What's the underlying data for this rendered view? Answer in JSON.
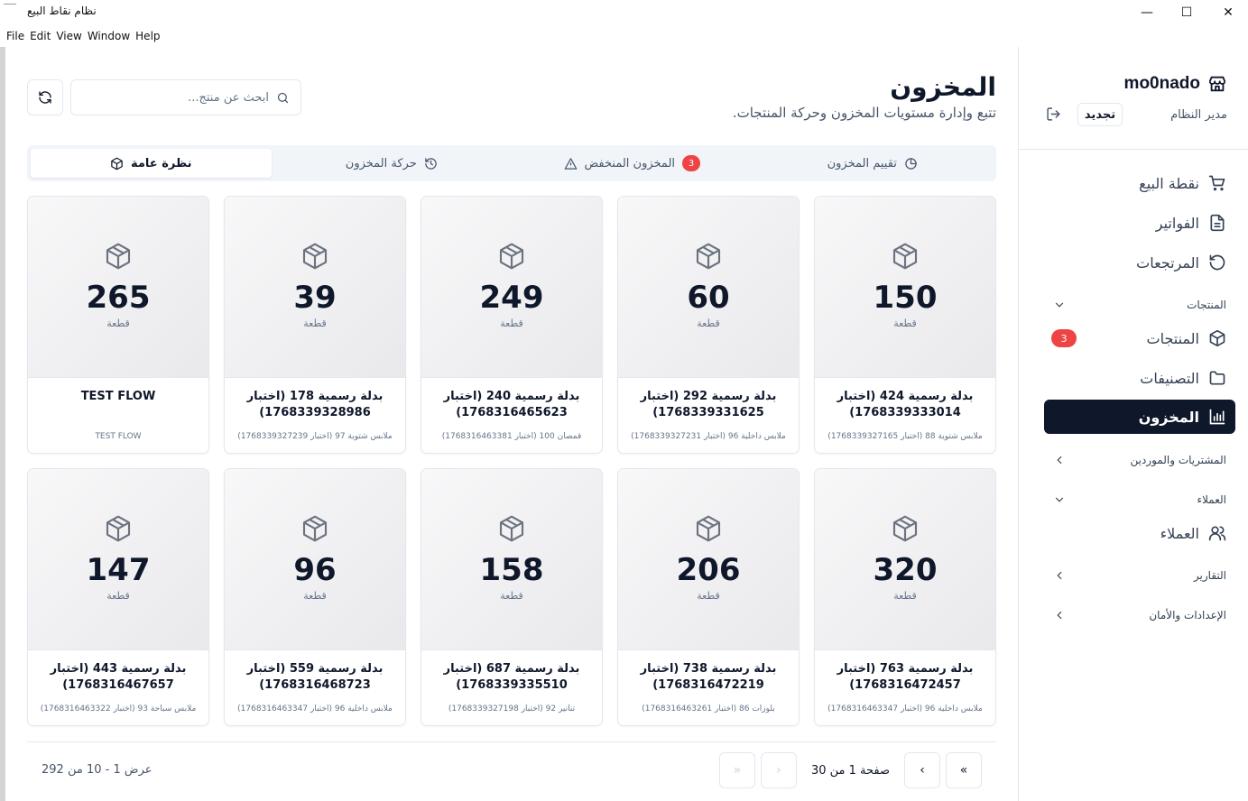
{
  "window": {
    "title": "نظام نقاط البيع",
    "controls": {
      "minimize": "—",
      "maximize": "☐",
      "close": "✕"
    }
  },
  "menu": [
    "File",
    "Edit",
    "View",
    "Window",
    "Help"
  ],
  "sidebar": {
    "brand": "mo0nado",
    "role": "مدير النظام",
    "renew_label": "تجديد",
    "items": [
      {
        "label": "نقطة البيع",
        "icon": "cart-icon"
      },
      {
        "label": "الفواتير",
        "icon": "file-icon"
      },
      {
        "label": "المرتجعات",
        "icon": "undo-icon"
      }
    ],
    "groups": {
      "products": "المنتجات",
      "purchases": "المشتريات والموردين",
      "customers": "العملاء",
      "reports": "التقارير",
      "settings": "الإعدادات والأمان"
    },
    "products_items": [
      {
        "label": "المنتجات",
        "badge": "3"
      },
      {
        "label": "التصنيفات"
      },
      {
        "label": "المخزون"
      }
    ],
    "customers_items": [
      {
        "label": "العملاء"
      }
    ]
  },
  "header": {
    "title": "المخزون",
    "subtitle": "تتبع وإدارة مستويات المخزون وحركة المنتجات.",
    "search_placeholder": "ابحث عن منتج..."
  },
  "tabs": [
    {
      "label": "تقييم المخزون"
    },
    {
      "label": "المخزون المنخفض",
      "badge": "3"
    },
    {
      "label": "حركة المخزون"
    },
    {
      "label": "نظرة عامة"
    }
  ],
  "unit_label": "قطعة",
  "products": [
    {
      "qty": "150",
      "name": "بدلة رسمية 424 (اختبار 1768339333014)",
      "category": "ملابس شتوية 88 (اختبار 1768339327165)"
    },
    {
      "qty": "60",
      "name": "بدلة رسمية 292 (اختبار 1768339331625)",
      "category": "ملابس داخلية 96 (اختبار 1768339327231)"
    },
    {
      "qty": "249",
      "name": "بدلة رسمية 240 (اختبار 1768316465623)",
      "category": "قمصان 100 (اختبار 1768316463381)"
    },
    {
      "qty": "39",
      "name": "بدلة رسمية 178 (اختبار 1768339328986)",
      "category": "ملابس شتوية 97 (اختبار 1768339327239)"
    },
    {
      "qty": "265",
      "name": "TEST FLOW",
      "category": "TEST FLOW"
    },
    {
      "qty": "320",
      "name": "بدلة رسمية 763 (اختبار 1768316472457)",
      "category": "ملابس داخلية 96 (اختبار 1768316463347)"
    },
    {
      "qty": "206",
      "name": "بدلة رسمية 738 (اختبار 1768316472219)",
      "category": "بلوزات 86 (اختبار 1768316463261)"
    },
    {
      "qty": "158",
      "name": "بدلة رسمية 687 (اختبار 1768339335510)",
      "category": "تنانير 92 (اختبار 1768339327198)"
    },
    {
      "qty": "96",
      "name": "بدلة رسمية 559 (اختبار 1768316468723)",
      "category": "ملابس داخلية 96 (اختبار 1768316463347)"
    },
    {
      "qty": "147",
      "name": "بدلة رسمية 443 (اختبار 1768316467657)",
      "category": "ملابس سباحة 93 (اختبار 1768316463322)"
    }
  ],
  "pagination": {
    "page_info": "صفحة 1 من 30",
    "showing": "عرض 1 - 10 من 292",
    "first": "»",
    "prev": "›",
    "next": "‹",
    "last": "«"
  },
  "colors": {
    "accent": "#0f172a",
    "badge": "#ef4444"
  }
}
